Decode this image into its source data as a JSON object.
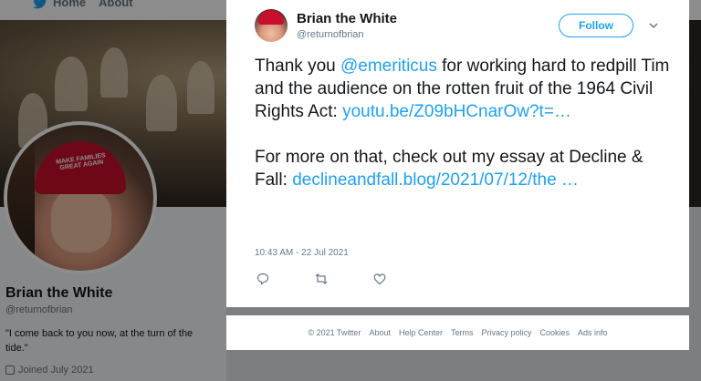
{
  "topnav": {
    "home_label": "Home",
    "about_label": "About"
  },
  "profile": {
    "name": "Brian the White",
    "handle": "@returnofbrian",
    "bio": "\"I come back to you now, at the turn of the tide.\"",
    "joined": "Joined July 2021",
    "hat_text": "MAKE FAMILIES GREAT AGAIN"
  },
  "tweet": {
    "author_name": "Brian the White",
    "author_handle": "@returnofbrian",
    "follow_label": "Follow",
    "text_1": "Thank you ",
    "mention": "@emeriticus",
    "text_2": " for working hard to redpill Tim and the audience on the rotten fruit of the 1964 Civil Rights Act: ",
    "link_1": "youtu.be/Z09bHCnarOw?t=…",
    "text_3": "For more on that, check out my essay at Decline & Fall: ",
    "link_2": "declineandfall.blog/2021/07/12/the …",
    "timestamp": "10:43 AM - 22 Jul 2021",
    "actions": [
      "reply-icon",
      "retweet-icon",
      "like-icon"
    ]
  },
  "footer": {
    "links": [
      "© 2021 Twitter",
      "About",
      "Help Center",
      "Terms",
      "Privacy policy",
      "Cookies",
      "Ads info"
    ]
  },
  "colors": {
    "accent": "#1da1f2",
    "muted": "#657786",
    "text": "#14171a"
  }
}
